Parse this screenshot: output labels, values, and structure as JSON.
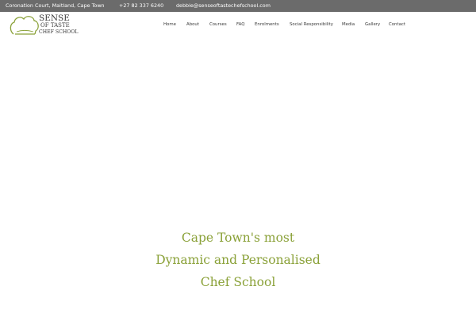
{
  "topbar": {
    "address": "Coronation Court, Maitland, Cape Town",
    "phone": "+27 82 337 6240",
    "email": "debbie@senseoftastechefschool.com"
  },
  "logo": {
    "line1": "SENSE",
    "line2": "OF TASTE",
    "line3": "CHEF SCHOOL",
    "color_hat": "#8aa138"
  },
  "nav": {
    "items": [
      "Home",
      "About",
      "Courses",
      "FAQ",
      "Enrolments",
      "Social Responsibility",
      "Media",
      "Gallery",
      "Contact"
    ]
  },
  "hero": {
    "line1": "Cape Town's most",
    "line2": "Dynamic and Personalised",
    "line3": "Chef School"
  },
  "colors": {
    "topbar_bg": "#6b6b6b",
    "accent": "#8aa138"
  }
}
